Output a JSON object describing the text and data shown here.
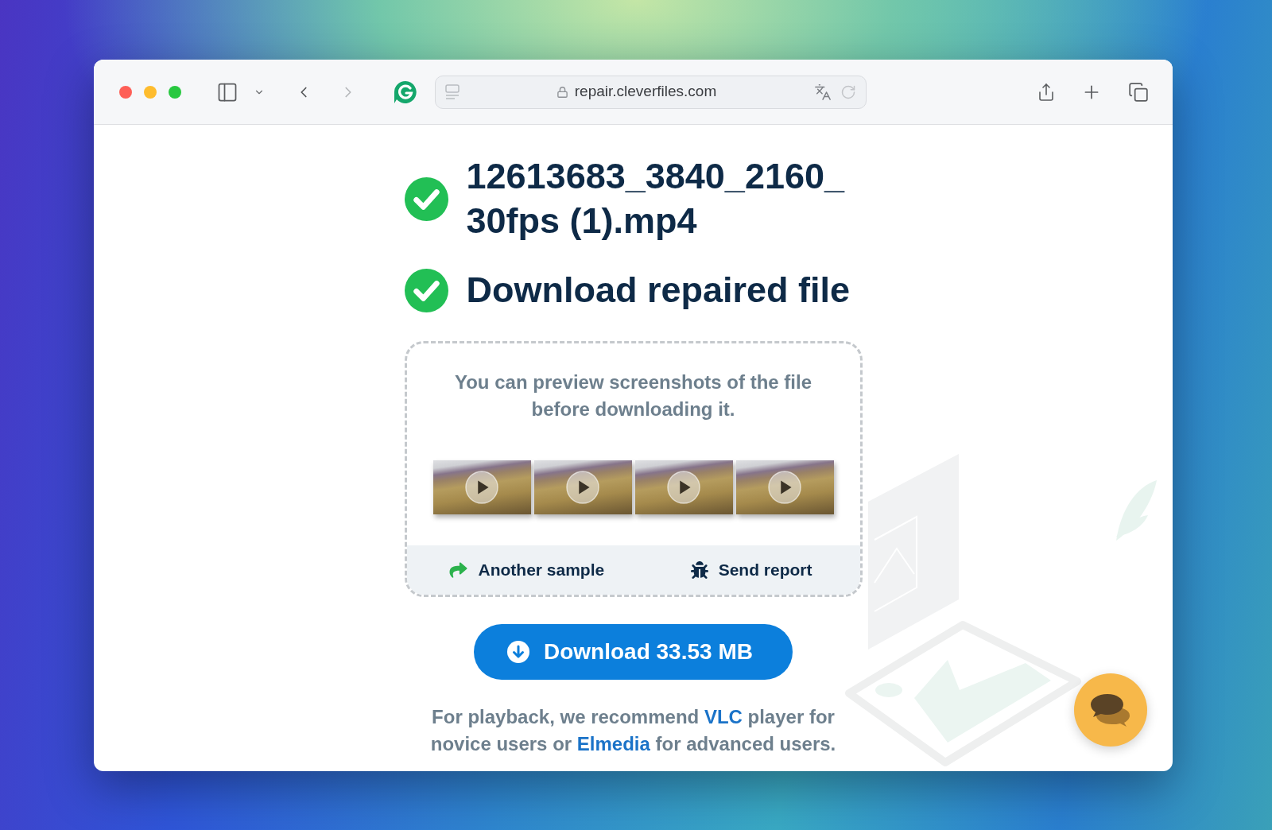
{
  "browser": {
    "url": "repair.cleverfiles.com",
    "nav_buttons": [
      {
        "kind": "back",
        "disabled": false
      },
      {
        "kind": "forward",
        "disabled": true
      }
    ]
  },
  "steps": [
    {
      "label": "12613683_3840_2160_30fps (1).mp4",
      "done": true
    },
    {
      "label": "Download repaired file",
      "done": true
    }
  ],
  "preview": {
    "message": "You can preview screenshots of the file before downloading it.",
    "thumbnails": [
      {
        "playable": true
      },
      {
        "playable": true
      },
      {
        "playable": true
      },
      {
        "playable": true
      }
    ],
    "actions": [
      {
        "kind": "redo",
        "label": "Another sample"
      },
      {
        "kind": "bug",
        "label": "Send report"
      }
    ]
  },
  "download_button": {
    "label": "Download 33.53 MB"
  },
  "note": [
    {
      "kind": "text",
      "text": "For playback, we recommend "
    },
    {
      "kind": "link",
      "text": "VLC"
    },
    {
      "kind": "text",
      "text": " player for novice users or "
    },
    {
      "kind": "link",
      "text": "Elmedia"
    },
    {
      "kind": "text",
      "text": " for advanced users."
    }
  ]
}
